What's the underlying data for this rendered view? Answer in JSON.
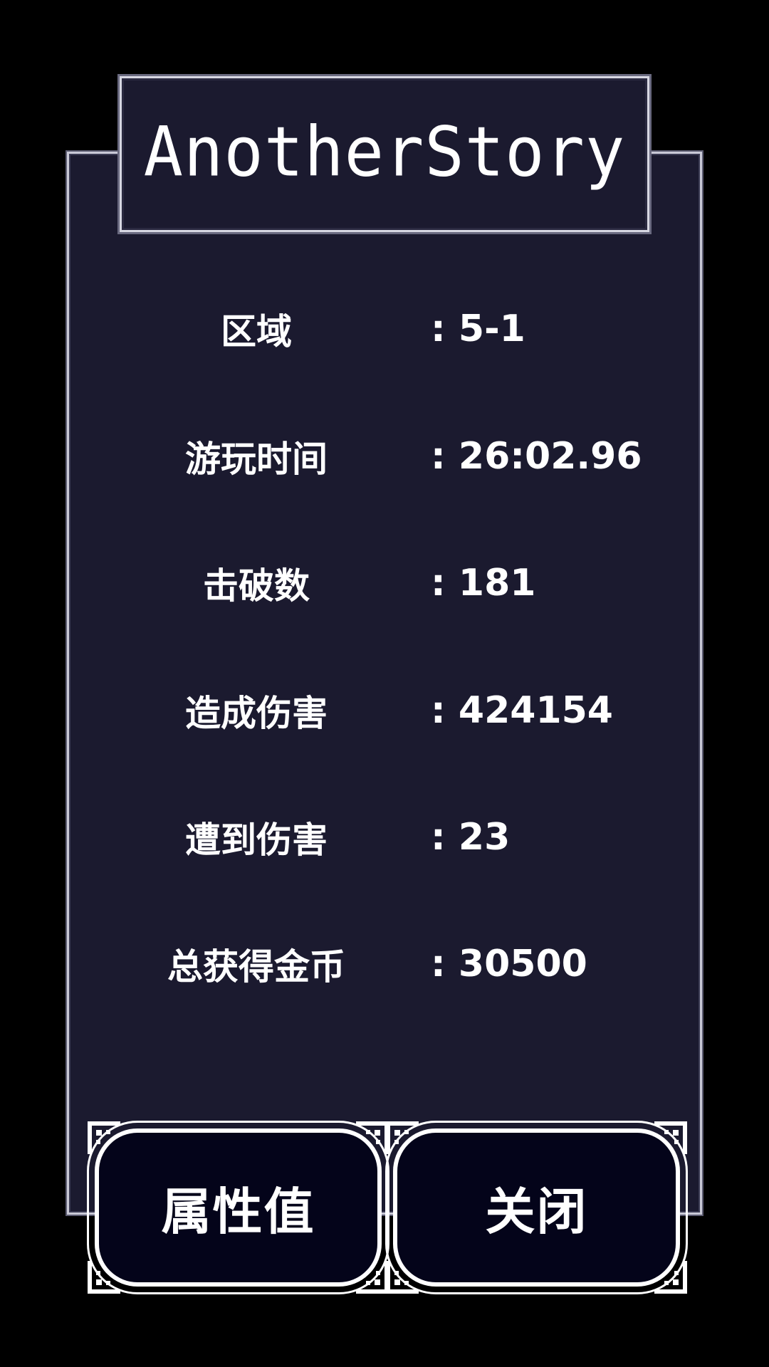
{
  "title": "AnotherStory",
  "stats": [
    {
      "label": "区域",
      "value": ": 5-1"
    },
    {
      "label": "游玩时间",
      "value": ": 26:02.96"
    },
    {
      "label": "击破数",
      "value": ": 181"
    },
    {
      "label": "造成伤害",
      "value": ": 424154"
    },
    {
      "label": "遭到伤害",
      "value": ": 23"
    },
    {
      "label": "总获得金币",
      "value": ": 30500"
    }
  ],
  "buttons": {
    "attributes_label": "属性值",
    "close_label": "关闭"
  },
  "colors": {
    "background": "#000000",
    "panel": "#1b1a2f",
    "border": "#c9c9d6",
    "text": "#ffffff",
    "button_fill": "#04041a"
  }
}
